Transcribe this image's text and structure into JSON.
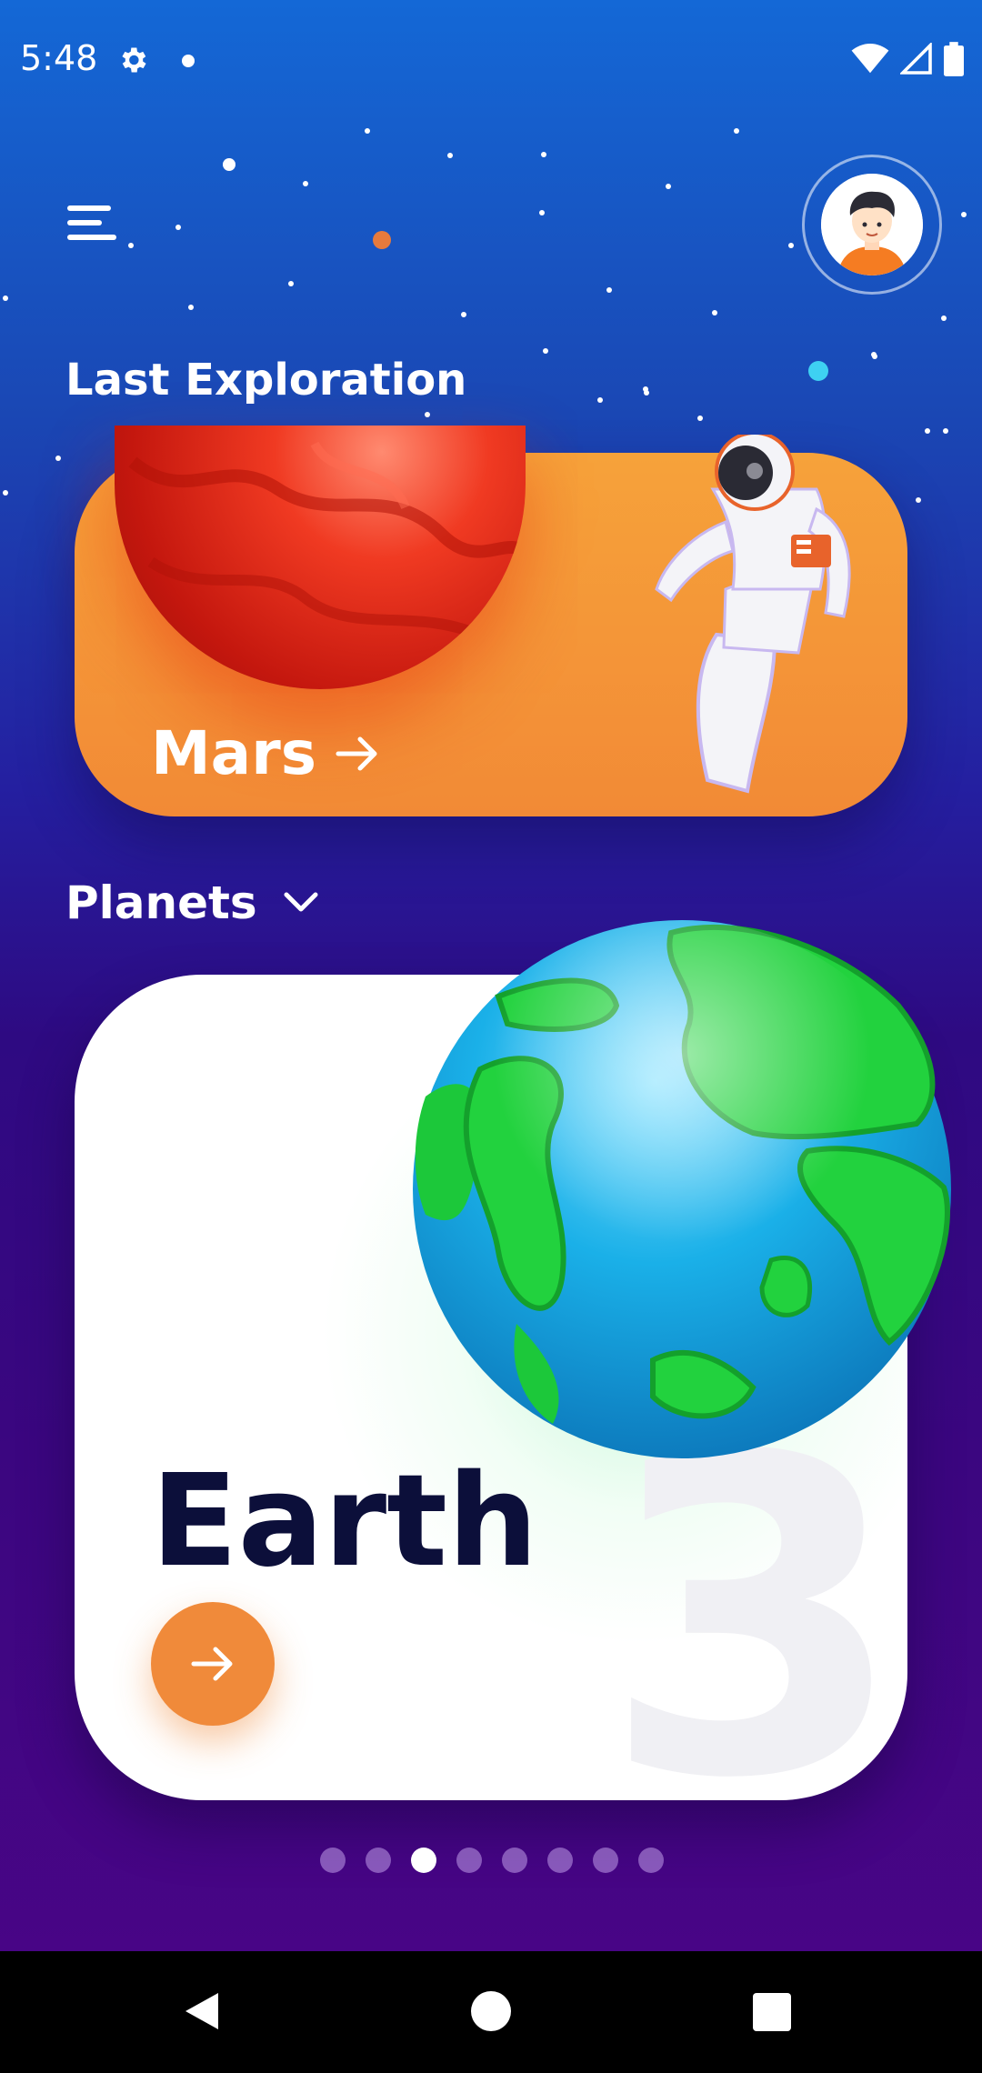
{
  "status_bar": {
    "time": "5:48",
    "icons": [
      "settings-icon",
      "notification-dot",
      "wifi-icon",
      "cellular-icon",
      "battery-icon"
    ]
  },
  "header": {
    "menu_icon": "menu-icon",
    "avatar": "user-avatar"
  },
  "last_exploration": {
    "title": "Last Exploration",
    "card": {
      "name": "Mars",
      "arrow_icon": "arrow-right-icon",
      "color": "#f28a36"
    }
  },
  "planets": {
    "title": "Planets",
    "dropdown_icon": "chevron-down-icon",
    "current": {
      "name": "Earth",
      "number": "3",
      "go_icon": "arrow-right-icon",
      "accent": "#f08a3a"
    },
    "pager": {
      "total": 8,
      "active_index": 2
    }
  },
  "nav_bar": {
    "icons": [
      "back-icon",
      "home-icon",
      "recents-icon"
    ]
  }
}
